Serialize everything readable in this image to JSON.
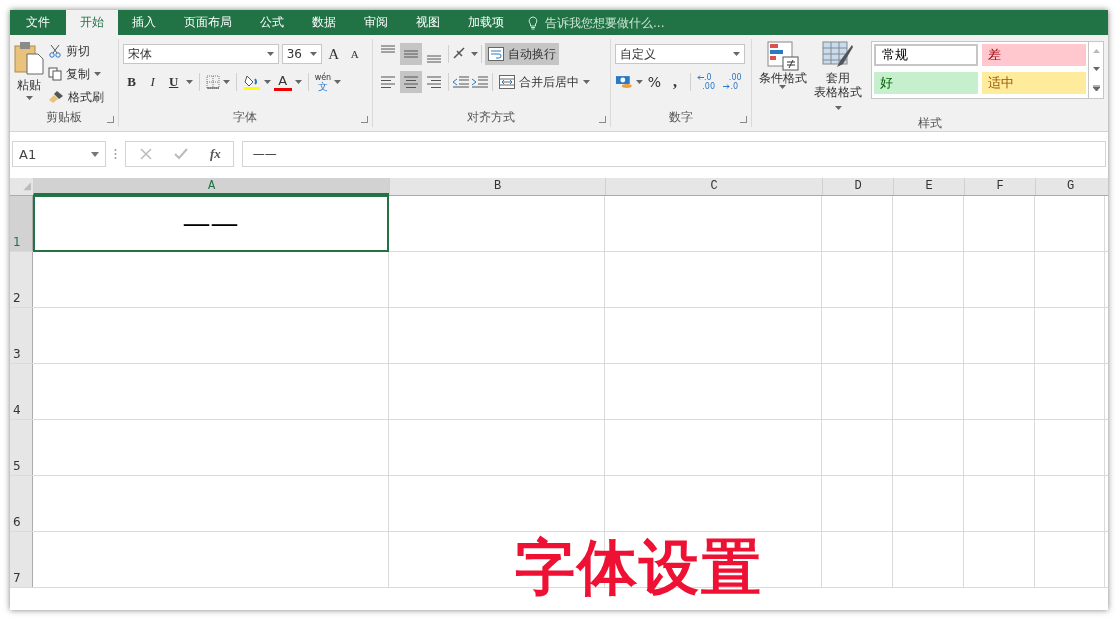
{
  "ribbon_tabs": [
    {
      "label": "文件",
      "selected": false
    },
    {
      "label": "开始",
      "selected": true
    },
    {
      "label": "插入",
      "selected": false
    },
    {
      "label": "页面布局",
      "selected": false
    },
    {
      "label": "公式",
      "selected": false
    },
    {
      "label": "数据",
      "selected": false
    },
    {
      "label": "审阅",
      "selected": false
    },
    {
      "label": "视图",
      "selected": false
    },
    {
      "label": "加载项",
      "selected": false
    }
  ],
  "tell_me": {
    "placeholder": "告诉我您想要做什么..."
  },
  "clipboard": {
    "paste": "粘贴",
    "cut": "剪切",
    "copy": "复制",
    "format_painter": "格式刷",
    "group_label": "剪贴板"
  },
  "font": {
    "name": "宋体",
    "size": "36",
    "grow": "A",
    "shrink": "A",
    "bold": "B",
    "italic": "I",
    "underline": "U",
    "font_color": "A",
    "phonetic_top": "wén",
    "phonetic_bottom": "文",
    "group_label": "字体"
  },
  "alignment": {
    "top_row": [
      {
        "kind": "top",
        "selected": false
      },
      {
        "kind": "middle",
        "selected": true
      },
      {
        "kind": "bottom",
        "selected": false
      }
    ],
    "bottom_row": [
      {
        "kind": "left",
        "selected": false
      },
      {
        "kind": "center",
        "selected": true
      },
      {
        "kind": "right",
        "selected": false
      }
    ],
    "wrap_text": {
      "label": "自动换行",
      "selected": true
    },
    "merge": {
      "label": "合并后居中",
      "selected": false
    },
    "group_label": "对齐方式"
  },
  "number": {
    "format": "自定义",
    "percent": "%",
    "comma": ",",
    "increase_decimal": [
      ".0",
      ".00"
    ],
    "decrease_decimal": [
      ".00",
      ".0"
    ],
    "group_label": "数字"
  },
  "styles": {
    "conditional_formatting": "条件格式",
    "format_as_table": [
      "套用",
      "表格格式"
    ],
    "cell_styles": [
      {
        "label": "常规",
        "color": "#ffffff"
      },
      {
        "label": "差",
        "color": "#ffc7ce"
      },
      {
        "label": "好",
        "color": "#c6efce"
      },
      {
        "label": "适中",
        "color": "#ffeb9c"
      }
    ],
    "group_label": "样式"
  },
  "formula_bar": {
    "name_box": "A1",
    "fx": "fx",
    "formula": "——"
  },
  "columns": [
    {
      "label": "A",
      "selected": true
    },
    {
      "label": "B",
      "selected": false
    },
    {
      "label": "C",
      "selected": false
    },
    {
      "label": "D",
      "selected": false
    },
    {
      "label": "E",
      "selected": false
    },
    {
      "label": "F",
      "selected": false
    },
    {
      "label": "G",
      "selected": false
    }
  ],
  "rows": [
    {
      "label": "1",
      "selected": true,
      "cells": [
        "——"
      ]
    },
    {
      "label": "2",
      "selected": false,
      "cells": []
    },
    {
      "label": "3",
      "selected": false,
      "cells": []
    },
    {
      "label": "4",
      "selected": false,
      "cells": []
    },
    {
      "label": "5",
      "selected": false,
      "cells": []
    },
    {
      "label": "6",
      "selected": false,
      "cells": []
    },
    {
      "label": "7",
      "selected": false,
      "cells": []
    }
  ],
  "caption": "字体设置"
}
